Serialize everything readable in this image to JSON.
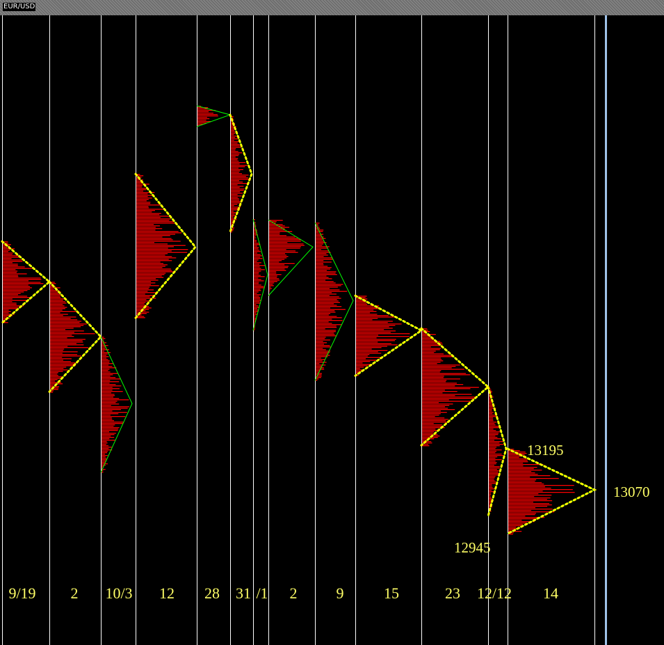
{
  "window": {
    "symbol": "EUR/USD"
  },
  "colors": {
    "background": "#000000",
    "profile": "#ff0000",
    "trend_line": "#00ff00",
    "dotted_line": "#ffff00",
    "separator": "#ffffff",
    "label": "#ffff66"
  },
  "chart_data": {
    "type": "market-profile",
    "grid": false,
    "date_labels": [
      "9/19",
      "2",
      "10/3",
      "12",
      "28",
      "31",
      "/1",
      "2",
      "9",
      "15",
      "23",
      "12/12",
      "14"
    ],
    "price_annotations": [
      {
        "label": "13195",
        "value": 1.3195
      },
      {
        "label": "13070",
        "value": 1.307
      },
      {
        "label": "12945",
        "value": 1.2945
      }
    ]
  }
}
